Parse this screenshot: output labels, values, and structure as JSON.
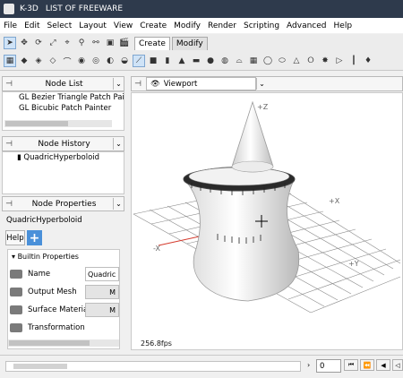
{
  "window": {
    "app_name": "K-3D",
    "title_suffix": "LIST OF FREEWARE"
  },
  "menu": [
    "File",
    "Edit",
    "Select",
    "Layout",
    "View",
    "Create",
    "Modify",
    "Render",
    "Scripting",
    "Advanced",
    "Help"
  ],
  "toolbar": {
    "tabs": [
      {
        "label": "Create"
      },
      {
        "label": "Modify"
      }
    ]
  },
  "node_list": {
    "title": "Node List",
    "items": [
      "GL Bezier Triangle Patch Painter",
      "GL Bicubic Patch Painter"
    ]
  },
  "node_history": {
    "title": "Node History",
    "items": [
      "QuadricHyperboloid"
    ]
  },
  "node_properties": {
    "title": "Node Properties",
    "node_name": "QuadricHyperboloid",
    "help_label": "Help",
    "add_symbol": "+",
    "section_title": "Builtin Properties",
    "properties": [
      {
        "label": "Name",
        "value": "Quadric"
      },
      {
        "label": "Output Mesh",
        "value": "M"
      },
      {
        "label": "Surface Material",
        "value": "M"
      },
      {
        "label": "Transformation",
        "value": ""
      }
    ]
  },
  "viewport": {
    "title": "Viewport",
    "fps": "256.8fps",
    "axis_labels": {
      "z": "+Z",
      "x_pos": "+X",
      "x_neg": "-X",
      "y_pos": "+Y"
    }
  },
  "timeline": {
    "frame": "0"
  },
  "colors": {
    "titlebar": "#2e3a4c",
    "selection": "#cfe3f7",
    "axis_red": "#d43a2c"
  }
}
